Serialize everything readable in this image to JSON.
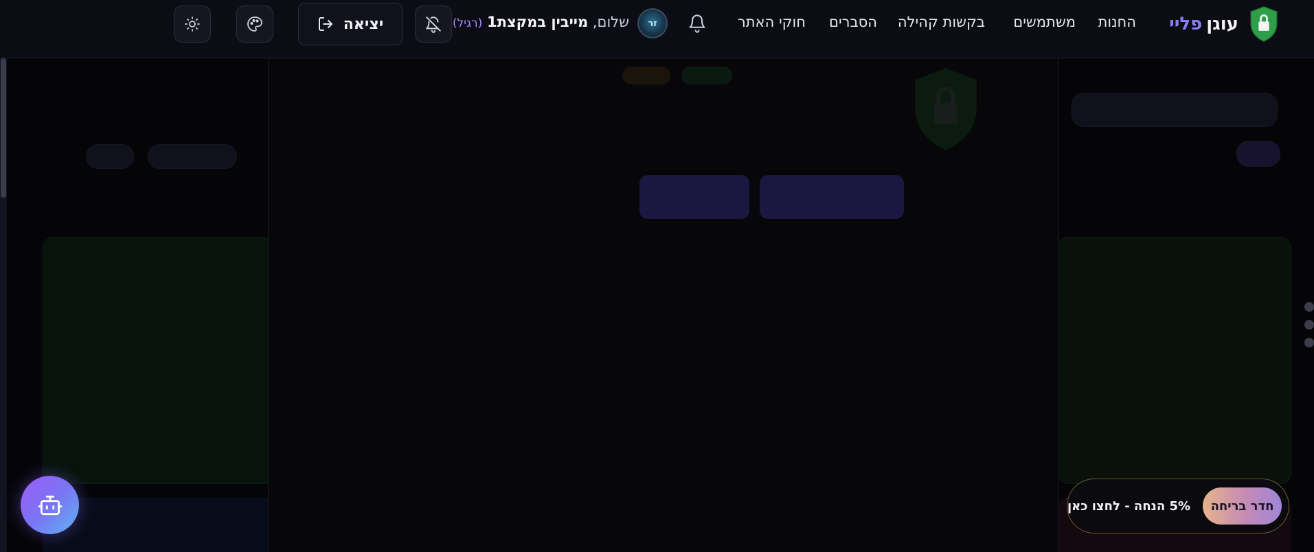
{
  "header": {
    "logo": {
      "word1": "עוגן",
      "word2": "פליי"
    },
    "nav": [
      {
        "label": "החנות"
      },
      {
        "label": "משתמשים"
      },
      {
        "label": "בקשות קהילה"
      },
      {
        "label": "הסברים"
      },
      {
        "label": "חוקי האתר"
      }
    ],
    "user": {
      "greeting": "שלום,",
      "name": "מייבין במקצת1",
      "role": "(רגיל)",
      "avatar_initials": "זר"
    },
    "logout_label": "יציאה"
  },
  "floating": {
    "promo_chip": "חדר בריחה",
    "promo_text": "5% הנחה - לחצו כאן"
  },
  "colors": {
    "accent_purple": "#8b7cf6",
    "shield_green": "#2f9e4a",
    "role_purple": "#a58bf5",
    "promo_border": "#6f5a2f"
  },
  "icons": {
    "logo": "shield-lock-icon",
    "bell": "bell-icon",
    "bell_off": "bell-off-icon",
    "logout": "logout-icon",
    "palette": "palette-icon",
    "theme": "sun-icon",
    "bot": "robot-icon"
  }
}
